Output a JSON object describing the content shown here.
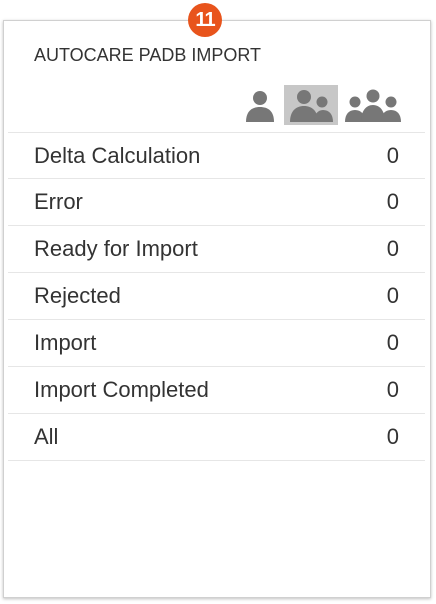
{
  "badge": {
    "text": "11",
    "color": "#e8541c"
  },
  "card": {
    "title": "AUTOCARE PADB IMPORT",
    "view_icons": [
      "single-user-icon",
      "two-users-icon",
      "group-users-icon"
    ],
    "selected_view": "two-users-icon",
    "rows": [
      {
        "label": "Delta Calculation",
        "count": "0"
      },
      {
        "label": "Error",
        "count": "0"
      },
      {
        "label": "Ready for Import",
        "count": "0"
      },
      {
        "label": "Rejected",
        "count": "0"
      },
      {
        "label": "Import",
        "count": "0"
      },
      {
        "label": "Import Completed",
        "count": "0"
      },
      {
        "label": "All",
        "count": "0"
      }
    ]
  }
}
